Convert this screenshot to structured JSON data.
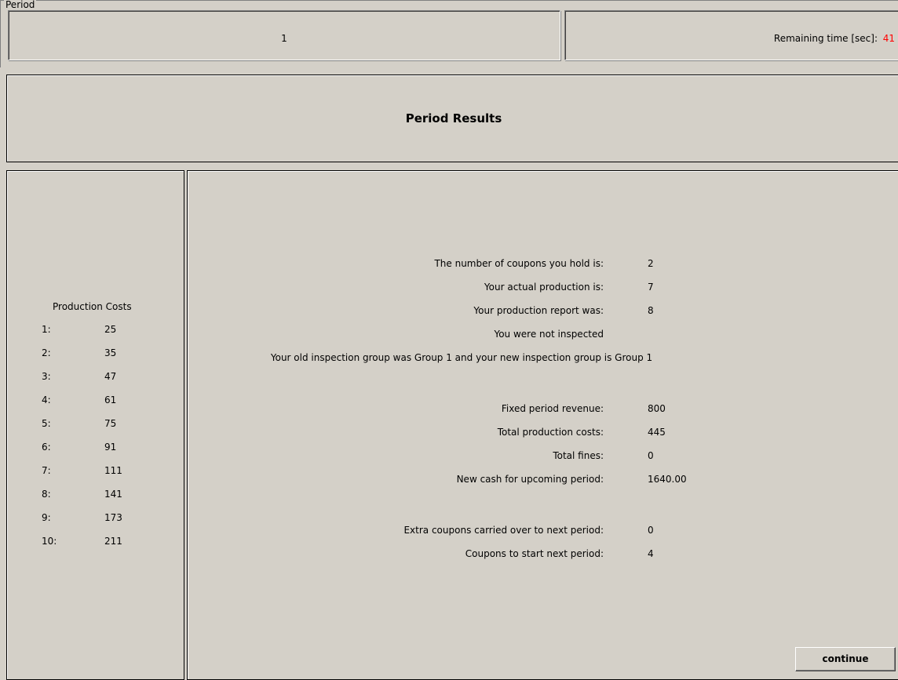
{
  "period": {
    "group_title": "Period",
    "value": "1",
    "remaining_label": "Remaining time [sec]:",
    "remaining_value": "41"
  },
  "header": {
    "title": "Period Results"
  },
  "production_costs": {
    "title": "Production Costs",
    "rows": [
      {
        "index": "1:",
        "value": "25"
      },
      {
        "index": "2:",
        "value": "35"
      },
      {
        "index": "3:",
        "value": "47"
      },
      {
        "index": "4:",
        "value": "61"
      },
      {
        "index": "5:",
        "value": "75"
      },
      {
        "index": "6:",
        "value": "91"
      },
      {
        "index": "7:",
        "value": "111"
      },
      {
        "index": "8:",
        "value": "141"
      },
      {
        "index": "9:",
        "value": "173"
      },
      {
        "index": "10:",
        "value": "211"
      }
    ]
  },
  "results": {
    "coupons_held_label": "The number of coupons you hold is:",
    "coupons_held_value": "2",
    "actual_production_label": "Your actual production is:",
    "actual_production_value": "7",
    "production_report_label": "Your production report was:",
    "production_report_value": "8",
    "inspection_status": "You were not inspected",
    "inspection_group_message": "Your old inspection group was Group 1 and your new inspection group is Group 1",
    "fixed_revenue_label": "Fixed period revenue:",
    "fixed_revenue_value": "800",
    "total_costs_label": "Total production costs:",
    "total_costs_value": "445",
    "total_fines_label": "Total fines:",
    "total_fines_value": "0",
    "new_cash_label": "New cash for upcoming period:",
    "new_cash_value": "1640.00",
    "extra_coupons_label": "Extra coupons carried over to next period:",
    "extra_coupons_value": "0",
    "next_coupons_label": "Coupons to start next period:",
    "next_coupons_value": "4"
  },
  "actions": {
    "continue_label": "continue"
  },
  "colors": {
    "background": "#d4d0c8",
    "timer": "#ff0000"
  }
}
